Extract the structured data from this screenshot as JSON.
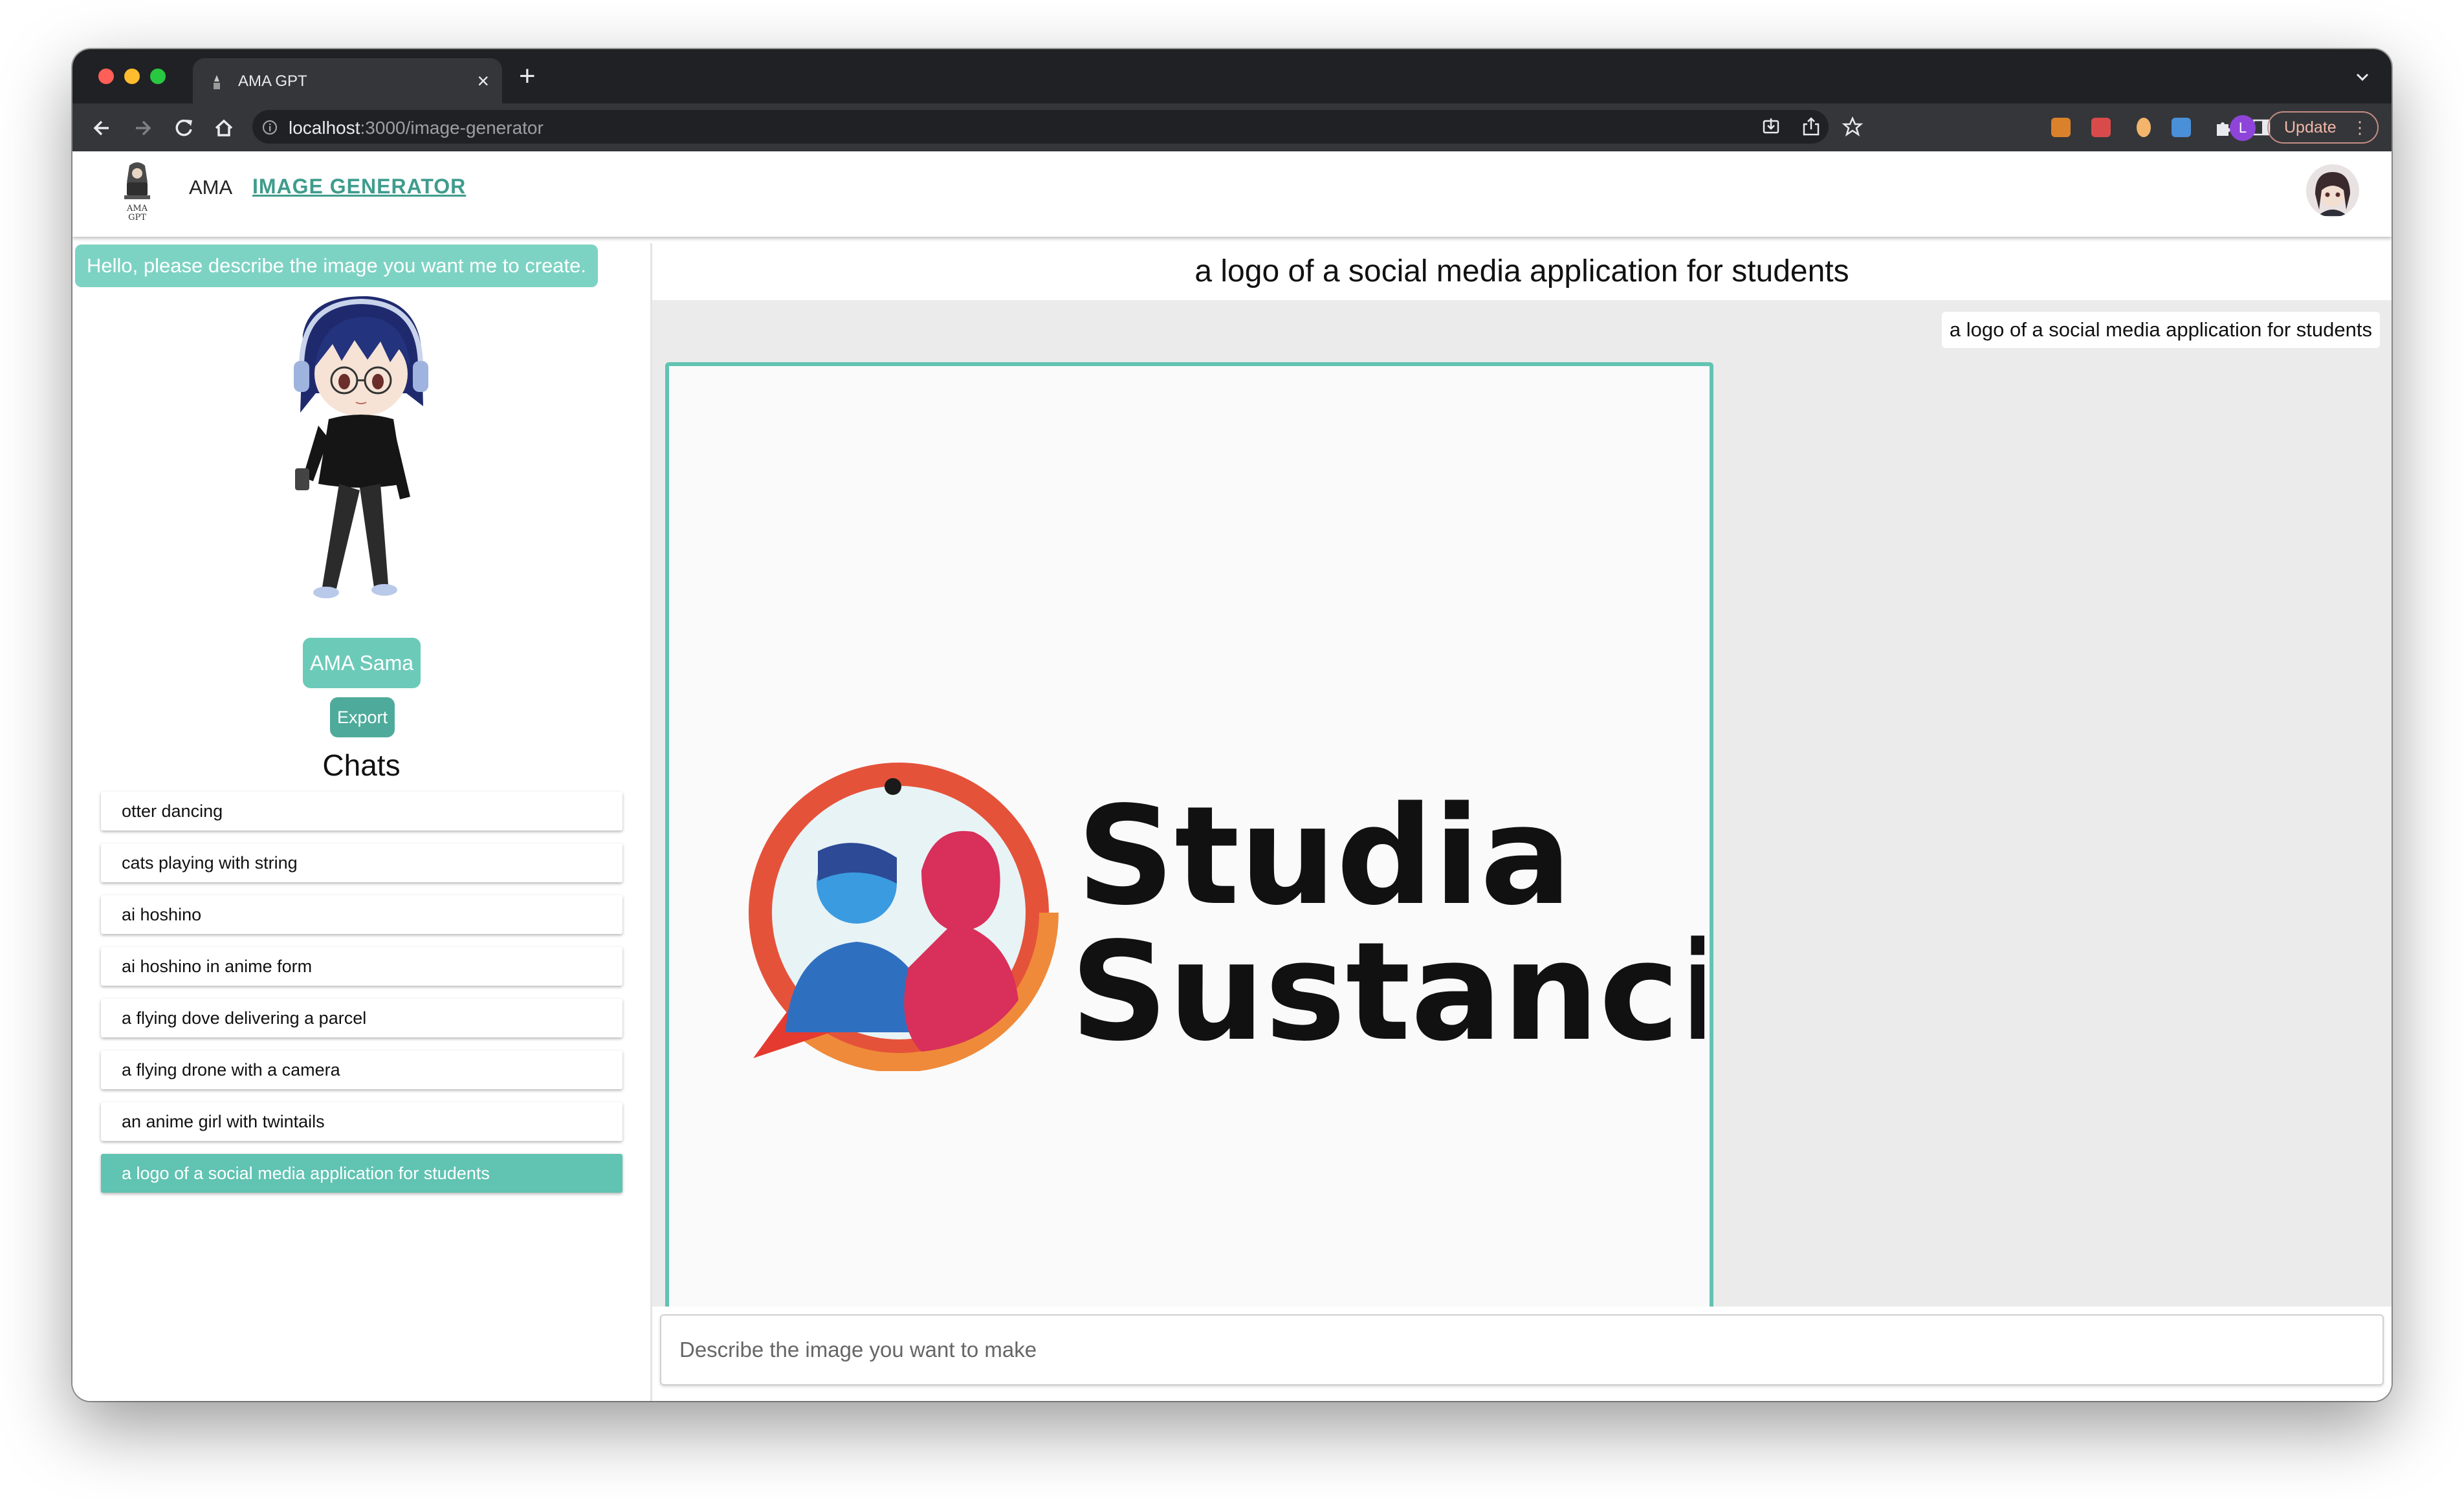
{
  "browser": {
    "tab_title": "AMA GPT",
    "url_host": "localhost",
    "url_path": ":3000/image-generator",
    "update_label": "Update",
    "profile_initial": "L"
  },
  "header": {
    "logo_text": "AMA GPT",
    "nav_ama": "AMA",
    "nav_image_generator": "IMAGE GENERATOR"
  },
  "sidebar": {
    "greeting": "Hello, please describe the image you want me to create.",
    "bot_name_button": "AMA Sama",
    "export_button": "Export",
    "chats_title": "Chats",
    "chats": [
      "otter dancing",
      "cats playing with string",
      "ai hoshino",
      "ai hoshino in anime form",
      "a flying dove delivering a parcel",
      "a flying drone with a camera",
      "an anime girl with twintails",
      "a logo of a social media application for students"
    ],
    "active_chat_index": 7
  },
  "main": {
    "title": "a logo of a social media application for students",
    "user_message": "a logo of a social media application for students",
    "generated_logo_text_line1": "Studia",
    "generated_logo_text_line2": "Sustancia",
    "prompt_placeholder": "Describe the image you want to make"
  },
  "colors": {
    "accent": "#61c3b2",
    "greeting_bg": "#7dd3c3",
    "nav_link": "#3f9c8d",
    "chrome_dark": "#202124",
    "chrome_toolbar": "#35363a"
  }
}
